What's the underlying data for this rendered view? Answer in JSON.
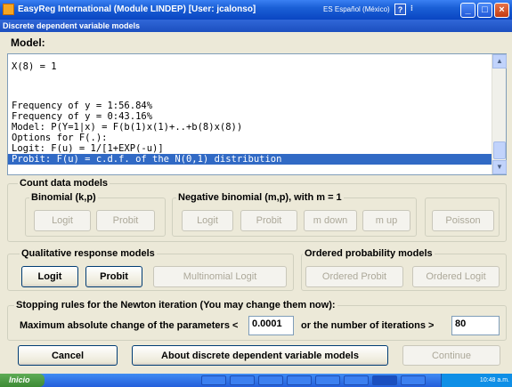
{
  "window": {
    "title": "EasyReg International (Module LINDEP) [User: jcalonso]",
    "language": "ES Español (México)",
    "help": "?",
    "subtitle": "Discrete dependent variable models"
  },
  "model": {
    "label": "Model:",
    "lines": [
      "X(8) = 1",
      "",
      "",
      "Frequency of y = 1:56.84%",
      "Frequency of y = 0:43.16%",
      "Model: P(Y=1|x) = F(b(1)x(1)+..+b(8)x(8))",
      "Options for F(.):",
      "Logit: F(u) = 1/[1+EXP(-u)]",
      "Probit: F(u) = c.d.f. of the N(0,1) distribution"
    ]
  },
  "count_models": {
    "title": "Count data models",
    "binomial": {
      "title": "Binomial (k,p)",
      "logit": "Logit",
      "probit": "Probit"
    },
    "negbin": {
      "title": "Negative binomial (m,p), with m = 1",
      "logit": "Logit",
      "probit": "Probit",
      "mdown": "m down",
      "mup": "m up"
    },
    "poisson": "Poisson"
  },
  "qualitative": {
    "title": "Qualitative response models",
    "logit": "Logit",
    "probit": "Probit",
    "multinomial": "Multinomial Logit"
  },
  "ordered": {
    "title": "Ordered probability models",
    "probit": "Ordered Probit",
    "logit": "Ordered Logit"
  },
  "stopping": {
    "title": "Stopping rules for the Newton iteration (You may change them now):",
    "max_change_label": "Maximum absolute change of the parameters <",
    "max_change_value": "0.0001",
    "iterations_label": "or the number of iterations >",
    "iterations_value": "80"
  },
  "footer": {
    "cancel": "Cancel",
    "about": "About discrete dependent variable models",
    "continue": "Continue"
  },
  "taskbar": {
    "start": "Inicio",
    "clock": "10:48 a.m."
  }
}
